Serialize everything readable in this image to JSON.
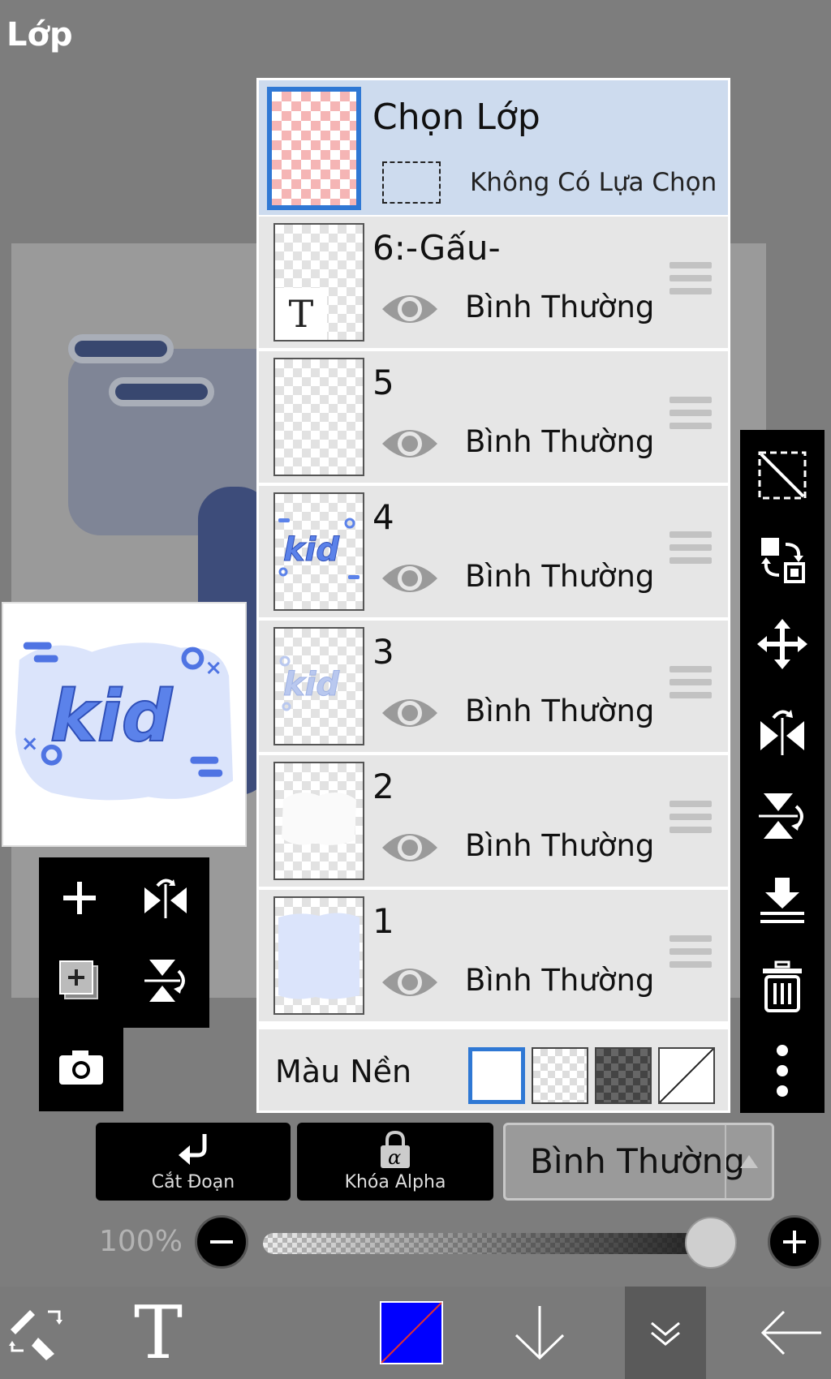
{
  "header": {
    "title": "Lớp"
  },
  "selection_layer": {
    "title": "Chọn Lớp",
    "status": "Không Có Lựa Chọn"
  },
  "layers": [
    {
      "name": "6:-Gấu-",
      "mode": "Bình Thường",
      "visible": true,
      "type": "text",
      "thumb_glyph": "T"
    },
    {
      "name": "5",
      "mode": "Bình Thường",
      "visible": true,
      "type": "empty"
    },
    {
      "name": "4",
      "mode": "Bình Thường",
      "visible": true,
      "type": "kid-dark"
    },
    {
      "name": "3",
      "mode": "Bình Thường",
      "visible": true,
      "type": "kid-light"
    },
    {
      "name": "2",
      "mode": "Bình Thường",
      "visible": true,
      "type": "white-cloud"
    },
    {
      "name": "1",
      "mode": "Bình Thường",
      "visible": true,
      "type": "blue-cloud"
    }
  ],
  "background": {
    "label": "Màu Nền",
    "options": [
      "white",
      "transparent-light",
      "transparent-dark",
      "none"
    ],
    "selected": "white"
  },
  "actions": {
    "clipping_label": "Cắt Đoạn",
    "alpha_lock_label": "Khóa Alpha",
    "blend_mode": "Bình Thường"
  },
  "opacity": {
    "label": "100%",
    "value": 1.0
  },
  "bottom_toolbar": {
    "items": [
      "brush-eraser-swap-icon",
      "text-tool-icon",
      "color-swatch",
      "arrow-down-icon",
      "double-chevron-down-icon",
      "arrow-left-icon"
    ],
    "text_glyph": "T",
    "color": "#0000ff"
  },
  "colors": {
    "accent": "#2f78d4",
    "selection_bg": "#cddbee",
    "layer_bg": "#e6e6e6"
  },
  "preview": {
    "text": "kid"
  }
}
